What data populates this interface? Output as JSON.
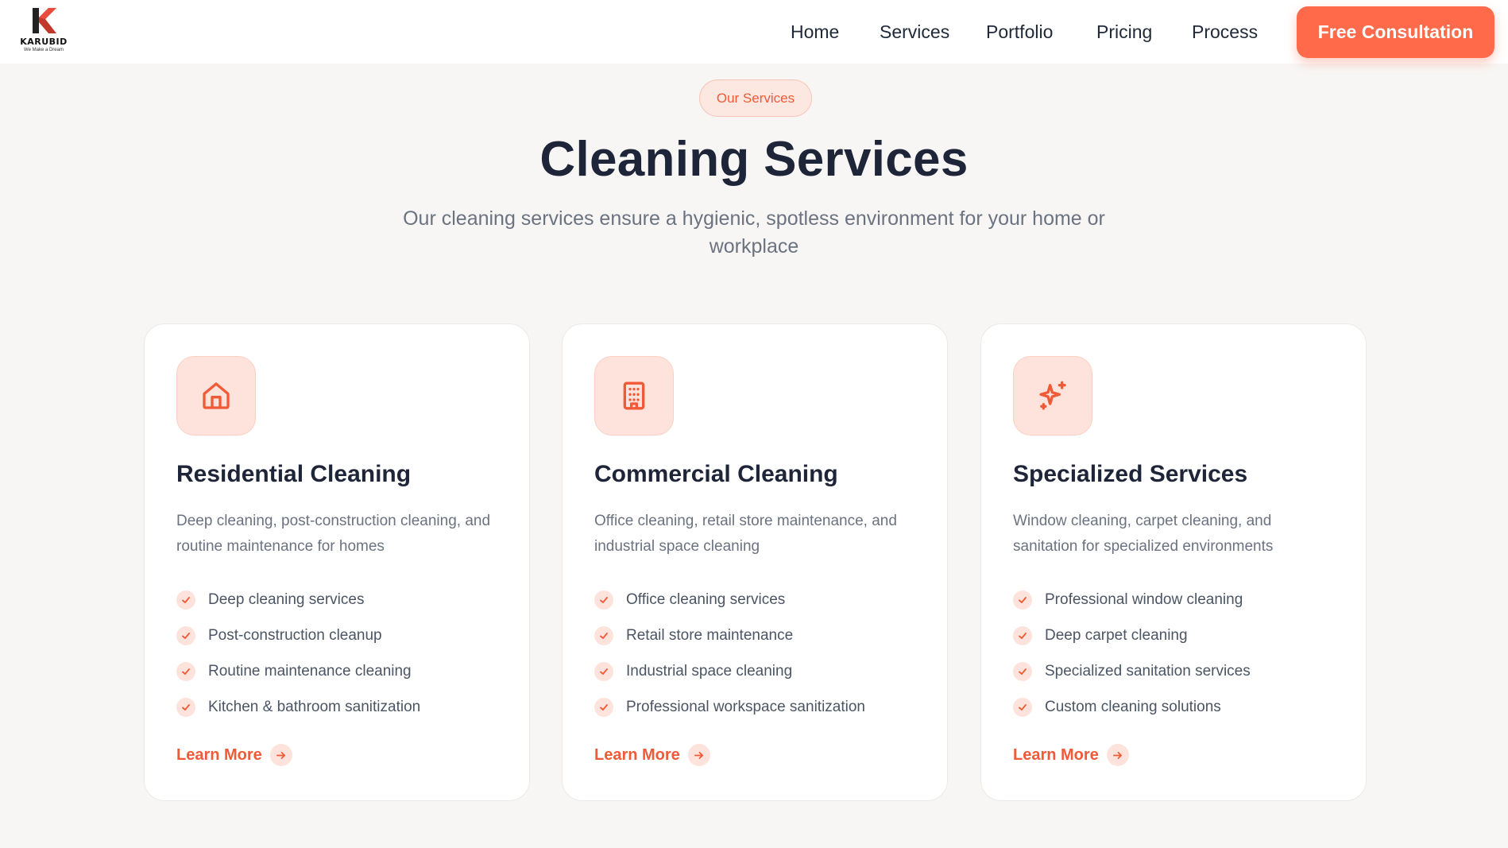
{
  "brand": {
    "name": "KARUBID",
    "tagline": "We Make a Dream",
    "accent": "#ff6b4a"
  },
  "nav": {
    "items": [
      "Home",
      "Services",
      "Portfolio",
      "Pricing",
      "Process"
    ],
    "cta": "Free Consultation"
  },
  "hero": {
    "pill": "Our Services",
    "title": "Cleaning Services",
    "subtitle": "Our cleaning services ensure a hygienic, spotless environment for your home or workplace"
  },
  "cards": [
    {
      "icon": "house-icon",
      "title": "Residential Cleaning",
      "description": "Deep cleaning, post-construction cleaning, and routine maintenance for homes",
      "features": [
        "Deep cleaning services",
        "Post-construction cleanup",
        "Routine maintenance cleaning",
        "Kitchen & bathroom sanitization"
      ],
      "link": "Learn More"
    },
    {
      "icon": "building-icon",
      "title": "Commercial Cleaning",
      "description": "Office cleaning, retail store maintenance, and industrial space cleaning",
      "features": [
        "Office cleaning services",
        "Retail store maintenance",
        "Industrial space cleaning",
        "Professional workspace sanitization"
      ],
      "link": "Learn More"
    },
    {
      "icon": "sparkles-icon",
      "title": "Specialized Services",
      "description": "Window cleaning, carpet cleaning, and sanitation for specialized environments",
      "features": [
        "Professional window cleaning",
        "Deep carpet cleaning",
        "Specialized sanitation services",
        "Custom cleaning solutions"
      ],
      "link": "Learn More"
    }
  ]
}
